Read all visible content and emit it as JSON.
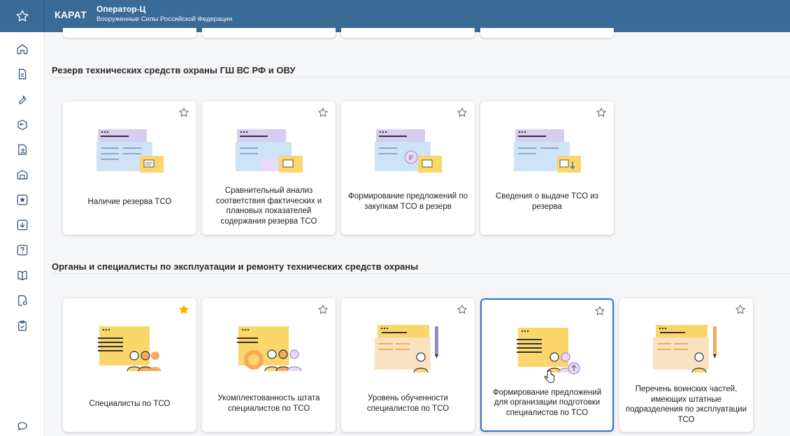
{
  "header": {
    "brand": "КАРАТ",
    "title": "Оператор-Ц",
    "subtitle": "Вооруженные Силы Российской Федерации"
  },
  "sidebar": {
    "items": [
      {
        "icon": "home-icon"
      },
      {
        "icon": "document-icon"
      },
      {
        "icon": "wrench-icon"
      },
      {
        "icon": "box-return-icon"
      },
      {
        "icon": "report-person-icon"
      },
      {
        "icon": "warehouse-icon"
      },
      {
        "icon": "star-box-icon"
      },
      {
        "icon": "box-download-icon"
      },
      {
        "icon": "question-icon"
      },
      {
        "icon": "book-icon"
      },
      {
        "icon": "document-settings-icon"
      },
      {
        "icon": "clipboard-check-icon"
      }
    ],
    "chat_icon": "chat-icon"
  },
  "sections": [
    {
      "title": "Резерв технических средств охраны ГШ ВС РФ и ОВУ",
      "cards": [
        {
          "label": "Наличие резерва ТСО",
          "favorite": false
        },
        {
          "label": "Сравнительный анализ соответствия фактических и плановых показателей содержания резерва ТСО",
          "favorite": false
        },
        {
          "label": "Формирование предложений по закупкам ТСО в резерв",
          "favorite": false
        },
        {
          "label": "Сведения о выдаче ТСО из резерва",
          "favorite": false
        }
      ]
    },
    {
      "title": "Органы и специалисты по эксплуатации и ремонту технических средств охраны",
      "cards": [
        {
          "label": "Специалисты по ТСО",
          "favorite": true
        },
        {
          "label": "Укомплектованность штата специалистов по ТСО",
          "favorite": false
        },
        {
          "label": "Уровень обученности специалистов по ТСО",
          "favorite": false
        },
        {
          "label": "Формирование предложений для организации подготовки специалистов по ТСО",
          "favorite": false,
          "active": true
        },
        {
          "label": "Перечень воинских частей, имеющих штатные подразделения по эксплуатации ТСО",
          "favorite": false
        }
      ]
    }
  ],
  "colors": {
    "header": "#3a6a96",
    "accent": "#2f74c4",
    "favorite": "#f4b400",
    "illustration_yellow": "#fbd66a",
    "illustration_lavender": "#d6cdf2",
    "illustration_blue": "#cfe3f6"
  }
}
